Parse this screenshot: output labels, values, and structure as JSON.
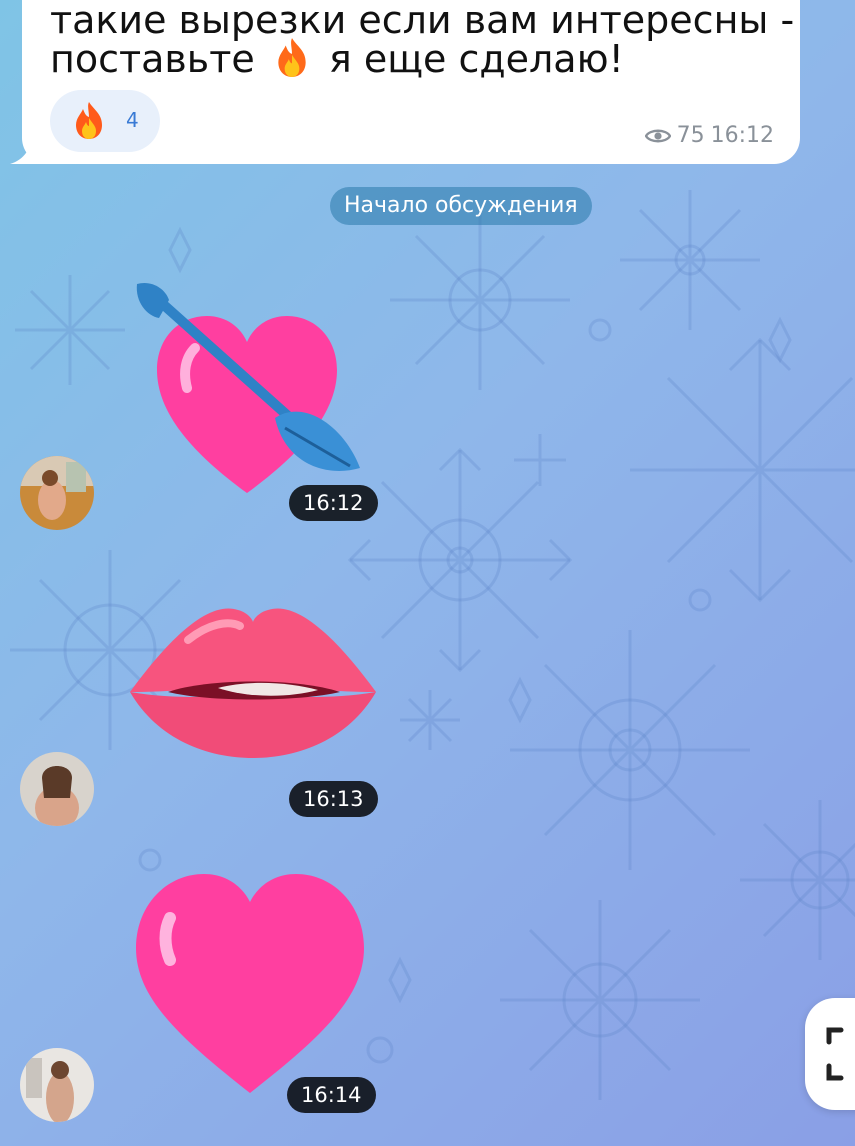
{
  "channel_post": {
    "text_line1": "такие вырезки если вам интересны -",
    "text_line2_before": "поставьте",
    "text_line2_after": "я еще сделаю!",
    "reaction": {
      "emoji_icon": "fire-icon",
      "count": "4"
    },
    "views": "75",
    "time": "16:12"
  },
  "service_message": "Начало обсуждения",
  "comments": [
    {
      "sticker": "heart-with-arrow",
      "time": "16:12"
    },
    {
      "sticker": "lips",
      "time": "16:13"
    },
    {
      "sticker": "pink-heart",
      "time": "16:14"
    }
  ],
  "colors": {
    "accent": "#3a7bd5",
    "bubble": "#ffffff",
    "heart_pink": "#ff3fa0",
    "arrow_blue": "#2f82c6"
  }
}
